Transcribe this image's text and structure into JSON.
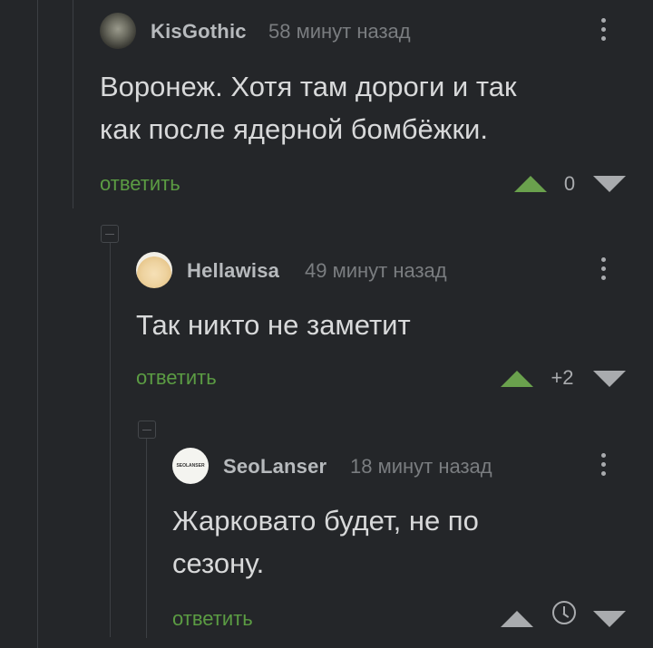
{
  "comments": [
    {
      "author": "KisGothic",
      "time": "58 минут назад",
      "text_lines": [
        "Воронеж. Хотя там дороги и так",
        "как после ядерной бомбёжки."
      ],
      "reply_label": "ответить",
      "rating": "0"
    },
    {
      "author": "Hellawisa",
      "time": "49 минут назад",
      "text_lines": [
        "Так никто не заметит"
      ],
      "reply_label": "ответить",
      "rating": "+2"
    },
    {
      "author": "SeoLanser",
      "avatar_text": "SEOLANSER",
      "time": "18 минут назад",
      "text_lines": [
        "Жарковато будет, не по",
        "сезону."
      ],
      "reply_label": "ответить",
      "rating": ""
    }
  ],
  "colors": {
    "background": "#242629",
    "reply_green": "#5b9c43",
    "vote_up_green": "#6aa14d",
    "muted": "#7a7d80"
  }
}
